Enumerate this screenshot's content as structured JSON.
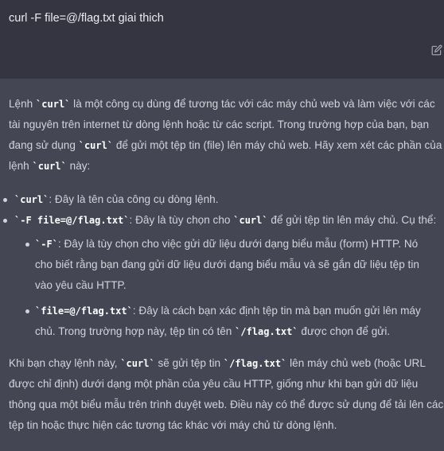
{
  "user": {
    "message": "curl -F file=@/flag.txt giai thich",
    "edit_icon": "pencil-square-icon"
  },
  "answer": {
    "p1": {
      "t1": "Lệnh ",
      "c1": "curl",
      "t2": " là một công cụ dùng để tương tác với các máy chủ web và làm việc với các tài nguyên trên internet từ dòng lệnh hoặc từ các script. Trong trường hợp của bạn, bạn đang sử dụng ",
      "c2": "curl",
      "t3": " để gửi một tệp tin (file) lên máy chủ web. Hãy xem xét các phần của lệnh ",
      "c3": "curl",
      "t4": " này:"
    },
    "bullets": {
      "b1": {
        "code": "curl",
        "text": ": Đây là tên của công cụ dòng lệnh."
      },
      "b2": {
        "code": "-F file=@/flag.txt",
        "t1": ": Đây là tùy chọn cho ",
        "c2": "curl",
        "t2": " để gửi tệp tin lên máy chủ. Cụ thể:"
      },
      "s1": {
        "code": "-F",
        "text": ": Đây là tùy chọn cho việc gửi dữ liệu dưới dạng biểu mẫu (form) HTTP. Nó cho biết rằng bạn đang gửi dữ liệu dưới dạng biểu mẫu và sẽ gắn dữ liệu tệp tin vào yêu cầu HTTP."
      },
      "s2": {
        "code": "file=@/flag.txt",
        "t1": ": Đây là cách bạn xác định tệp tin mà bạn muốn gửi lên máy chủ. Trong trường hợp này, tệp tin có tên ",
        "c2": "/flag.txt",
        "t2": " được chọn để gửi."
      }
    },
    "p2": {
      "t1": "Khi bạn chạy lệnh này, ",
      "c1": "curl",
      "t2": " sẽ gửi tệp tin ",
      "c2": "/flag.txt",
      "t3": " lên máy chủ web (hoặc URL được chỉ định) dưới dạng một phần của yêu cầu HTTP, giống như khi bạn gửi dữ liệu thông qua một biểu mẫu trên trình duyệt web. Điều này có thể được sử dụng để tải lên các tệp tin hoặc thực hiện các tương tác khác với máy chủ từ dòng lệnh."
    }
  }
}
